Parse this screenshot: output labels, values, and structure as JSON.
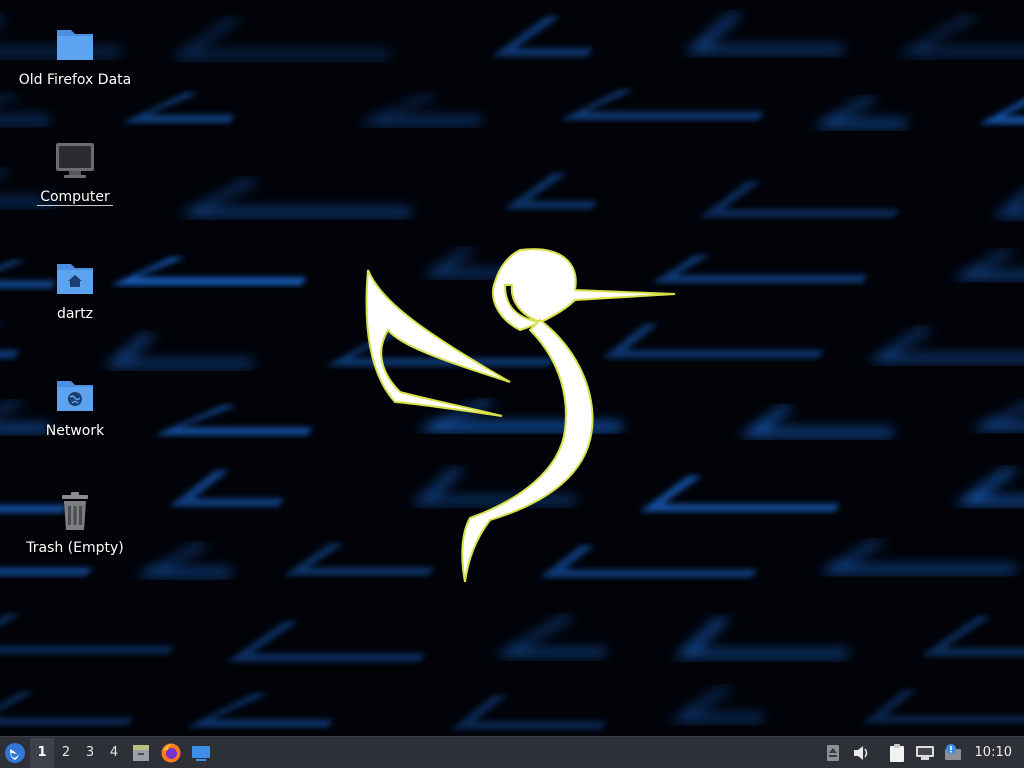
{
  "desktop": {
    "icons": [
      {
        "label": "Old Firefox Data",
        "icon": "folder-icon"
      },
      {
        "label": "Computer",
        "icon": "computer-icon"
      },
      {
        "label": "dartz",
        "icon": "home-folder-icon"
      },
      {
        "label": "Network",
        "icon": "network-folder-icon"
      },
      {
        "label": "Trash (Empty)",
        "icon": "trash-icon"
      }
    ],
    "wallpaper": {
      "accent": "#1e6fe0",
      "bird_color": "#ffffff",
      "bird_outline": "#d8e04a"
    }
  },
  "taskbar": {
    "start_icon": "linux-lite-logo-icon",
    "workspaces": [
      {
        "label": "1",
        "active": true
      },
      {
        "label": "2",
        "active": false
      },
      {
        "label": "3",
        "active": false
      },
      {
        "label": "4",
        "active": false
      }
    ],
    "launchers": [
      "file-manager-icon",
      "firefox-icon",
      "show-desktop-icon"
    ],
    "tray_icons": [
      "eject-icon",
      "volume-icon",
      "clipboard-icon",
      "network-icon",
      "updates-icon"
    ],
    "clock": "10:10"
  }
}
